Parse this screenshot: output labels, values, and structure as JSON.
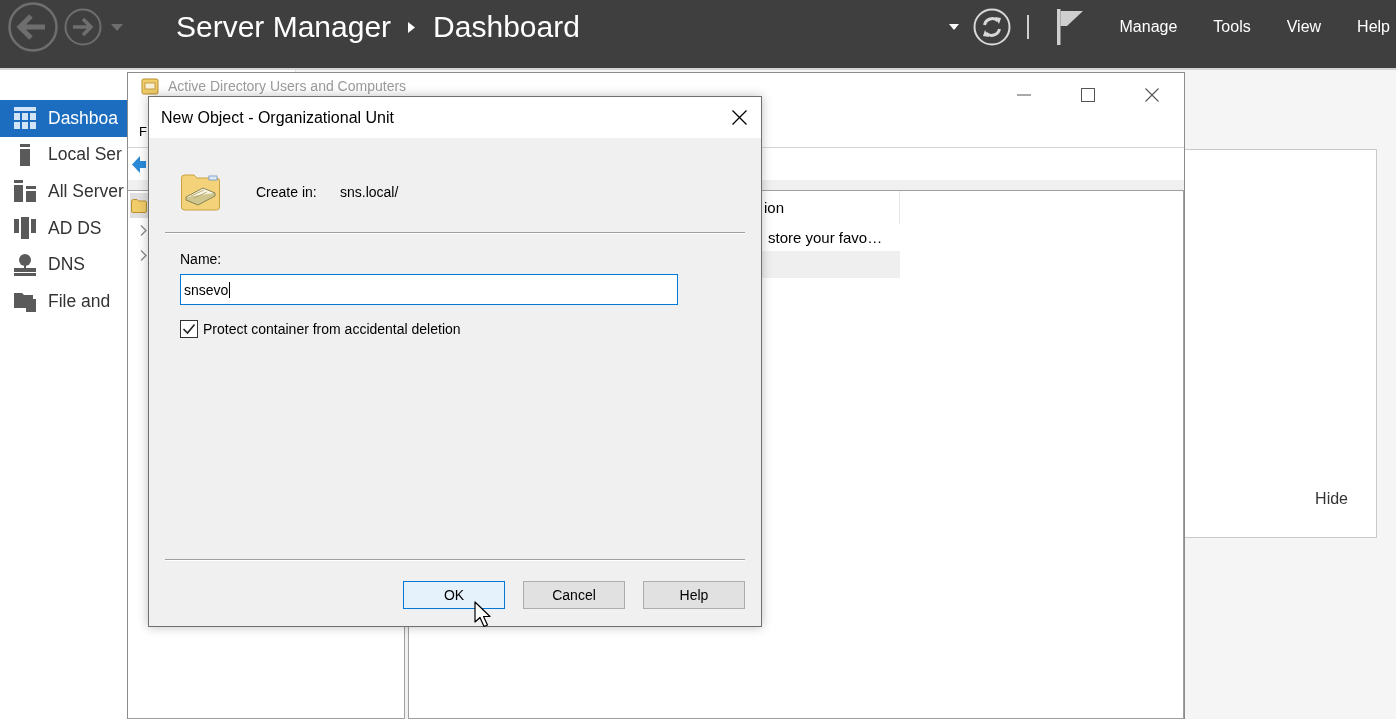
{
  "server_manager": {
    "header": {
      "title": "Server Manager",
      "page": "Dashboard",
      "menu": [
        "Manage",
        "Tools",
        "View",
        "Help"
      ]
    },
    "sidebar": {
      "items": [
        {
          "label": "Dashboa",
          "kind": "dashboard",
          "selected": true
        },
        {
          "label": "Local Ser",
          "kind": "local-server",
          "selected": false
        },
        {
          "label": "All Server",
          "kind": "all-servers",
          "selected": false
        },
        {
          "label": "AD DS",
          "kind": "ad-ds",
          "selected": false
        },
        {
          "label": "DNS",
          "kind": "dns",
          "selected": false
        },
        {
          "label": "File and",
          "kind": "file-storage",
          "selected": false
        }
      ]
    },
    "welcome_panel": {
      "hide_link": "Hide"
    }
  },
  "aduc_window": {
    "title": "Active Directory Users and Computers",
    "active": false,
    "menu": [
      "F"
    ],
    "tree": [
      {
        "kind": "folder",
        "selected": true
      },
      {
        "kind": "collapsed",
        "selected": false
      },
      {
        "kind": "collapsed",
        "selected": false
      }
    ],
    "list": {
      "columns": [
        "ion"
      ],
      "rows": [
        {
          "text": "store your favo…",
          "selected": false
        },
        {
          "selected": true
        }
      ]
    }
  },
  "dialog": {
    "title": "New Object - Organizational Unit",
    "create_in": {
      "label": "Create in:",
      "value": "sns.local/"
    },
    "name": {
      "label": "Name:",
      "value": "snsevo"
    },
    "protect_checkbox": {
      "label": "Protect container from accidental deletion",
      "checked": true
    },
    "buttons": [
      {
        "label": "OK",
        "default": true
      },
      {
        "label": "Cancel",
        "default": false
      },
      {
        "label": "Help",
        "default": false
      }
    ]
  }
}
